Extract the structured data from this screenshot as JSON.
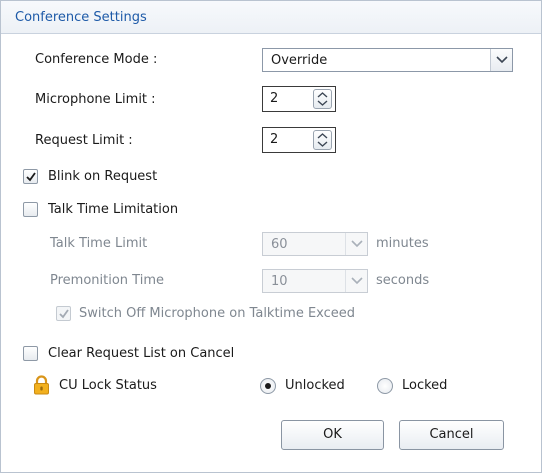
{
  "dialog": {
    "title": "Conference Settings"
  },
  "fields": {
    "conference_mode_label": "Conference Mode :",
    "conference_mode_value": "Override",
    "microphone_limit_label": "Microphone Limit :",
    "microphone_limit_value": "2",
    "request_limit_label": "Request Limit :",
    "request_limit_value": "2"
  },
  "options": {
    "blink_on_request_label": "Blink on Request",
    "blink_on_request_checked": true,
    "talk_time_limitation_label": "Talk Time Limitation",
    "talk_time_limitation_checked": false,
    "talk_time_limit_label": "Talk Time Limit",
    "talk_time_limit_value": "60",
    "talk_time_limit_unit": "minutes",
    "premonition_time_label": "Premonition Time",
    "premonition_time_value": "10",
    "premonition_time_unit": "seconds",
    "switch_off_mic_label": "Switch Off Microphone on Talktime Exceed",
    "switch_off_mic_checked": true,
    "clear_request_list_label": "Clear Request List on Cancel",
    "clear_request_list_checked": false
  },
  "lock": {
    "label": "CU Lock Status",
    "icon": "padlock-icon",
    "icon_color": "#f2b01e",
    "unlocked_label": "Unlocked",
    "locked_label": "Locked",
    "selected": "Unlocked"
  },
  "buttons": {
    "ok_label": "OK",
    "cancel_label": "Cancel"
  },
  "colors": {
    "title_text": "#1e5aa8",
    "disabled_text": "#7f8790"
  }
}
